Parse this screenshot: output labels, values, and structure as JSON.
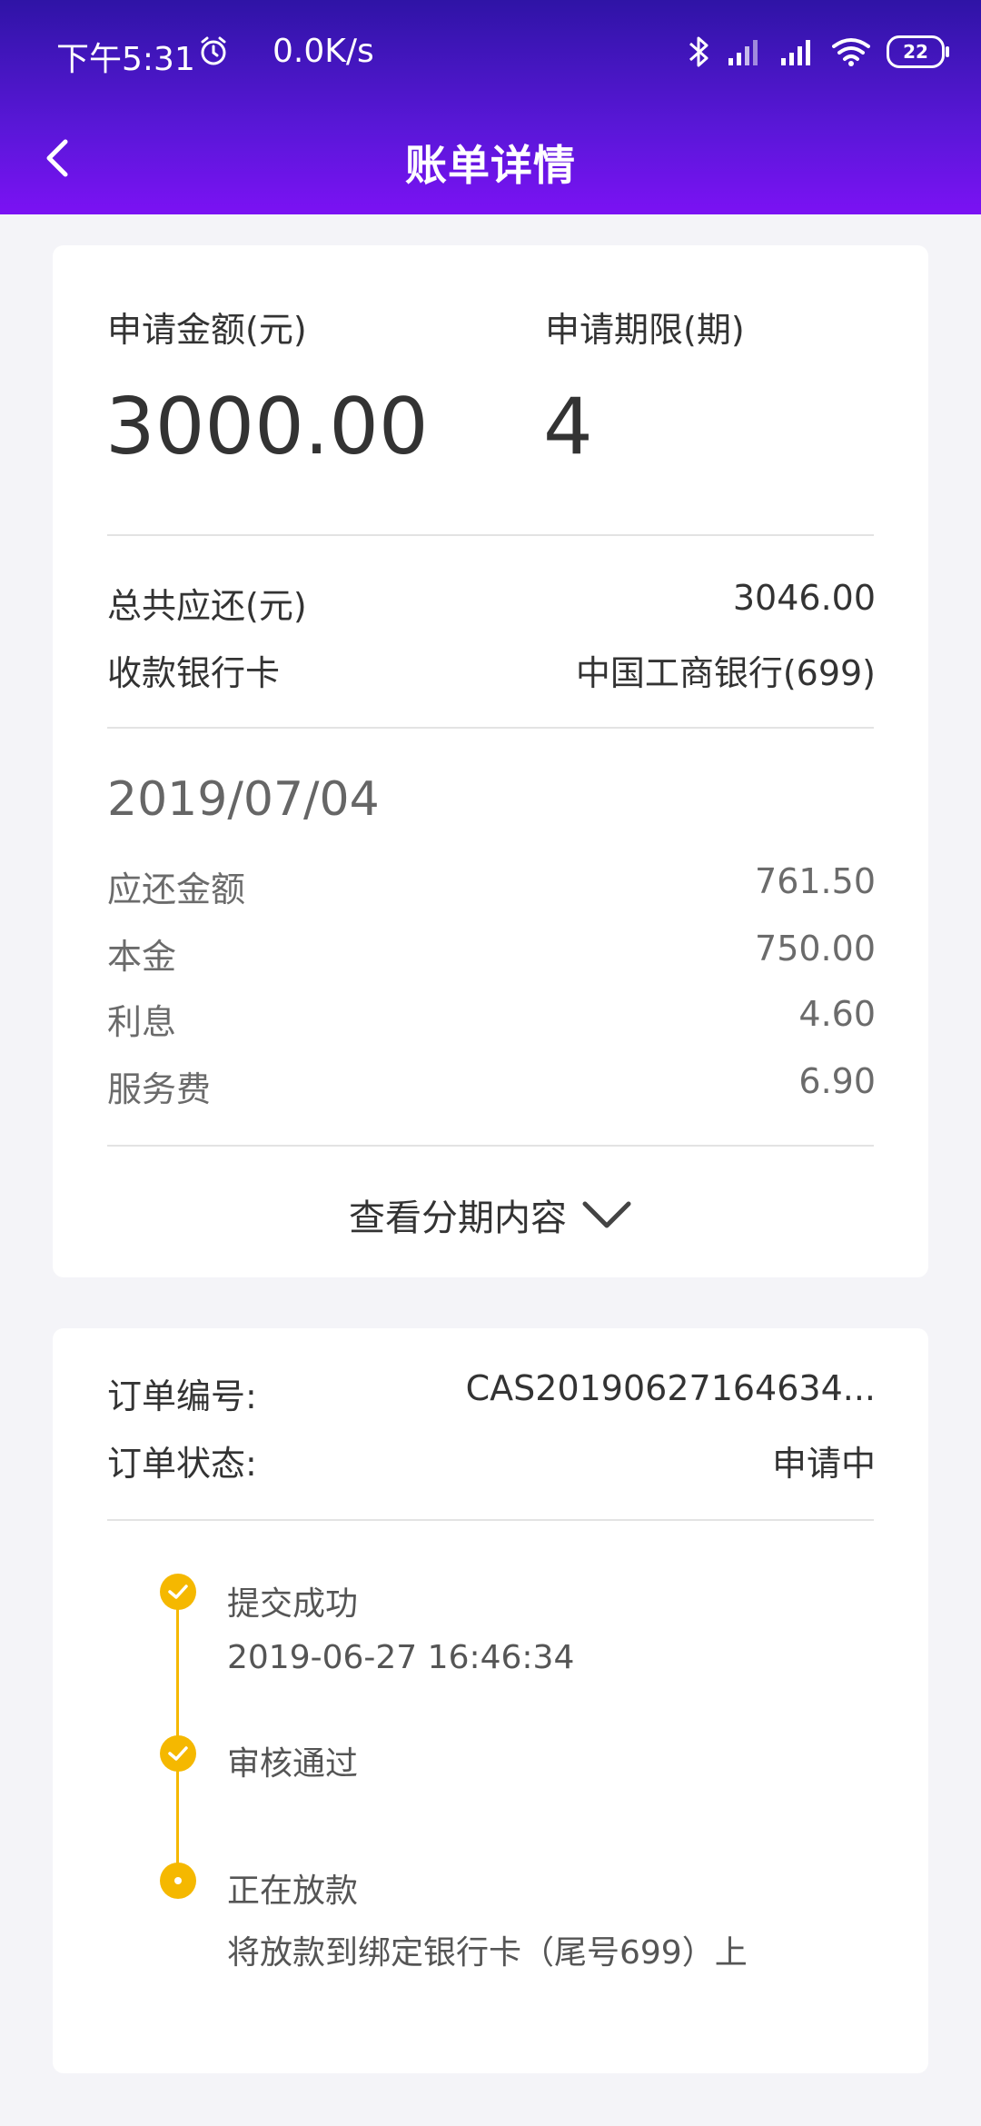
{
  "status_bar": {
    "time": "下午5:31",
    "speed": "0.0K/s",
    "battery": "22"
  },
  "header": {
    "title": "账单详情"
  },
  "summary": {
    "amount_label": "申请金额(元)",
    "amount_value": "3000.00",
    "term_label": "申请期限(期)",
    "term_value": "4",
    "total_label": "总共应还(元)",
    "total_value": "3046.00",
    "bank_label": "收款银行卡",
    "bank_value": "中国工商银行(699)"
  },
  "installment": {
    "date": "2019/07/04",
    "rows": [
      {
        "label": "应还金额",
        "value": "761.50"
      },
      {
        "label": "本金",
        "value": "750.00"
      },
      {
        "label": "利息",
        "value": "4.60"
      },
      {
        "label": "服务费",
        "value": "6.90"
      }
    ],
    "toggle_label": "查看分期内容"
  },
  "order": {
    "number_label": "订单编号:",
    "number_value": "CAS20190627164634...",
    "status_label": "订单状态:",
    "status_value": "申请中"
  },
  "timeline": [
    {
      "title": "提交成功",
      "sub": "2019-06-27 16:46:34"
    },
    {
      "title": "审核通过",
      "sub": ""
    },
    {
      "title": "正在放款",
      "sub": "将放款到绑定银行卡（尾号699）上"
    }
  ],
  "colors": {
    "header_top": "#2f14a6",
    "header_bottom": "#7b12f4",
    "timeline_accent": "#f5b800"
  }
}
